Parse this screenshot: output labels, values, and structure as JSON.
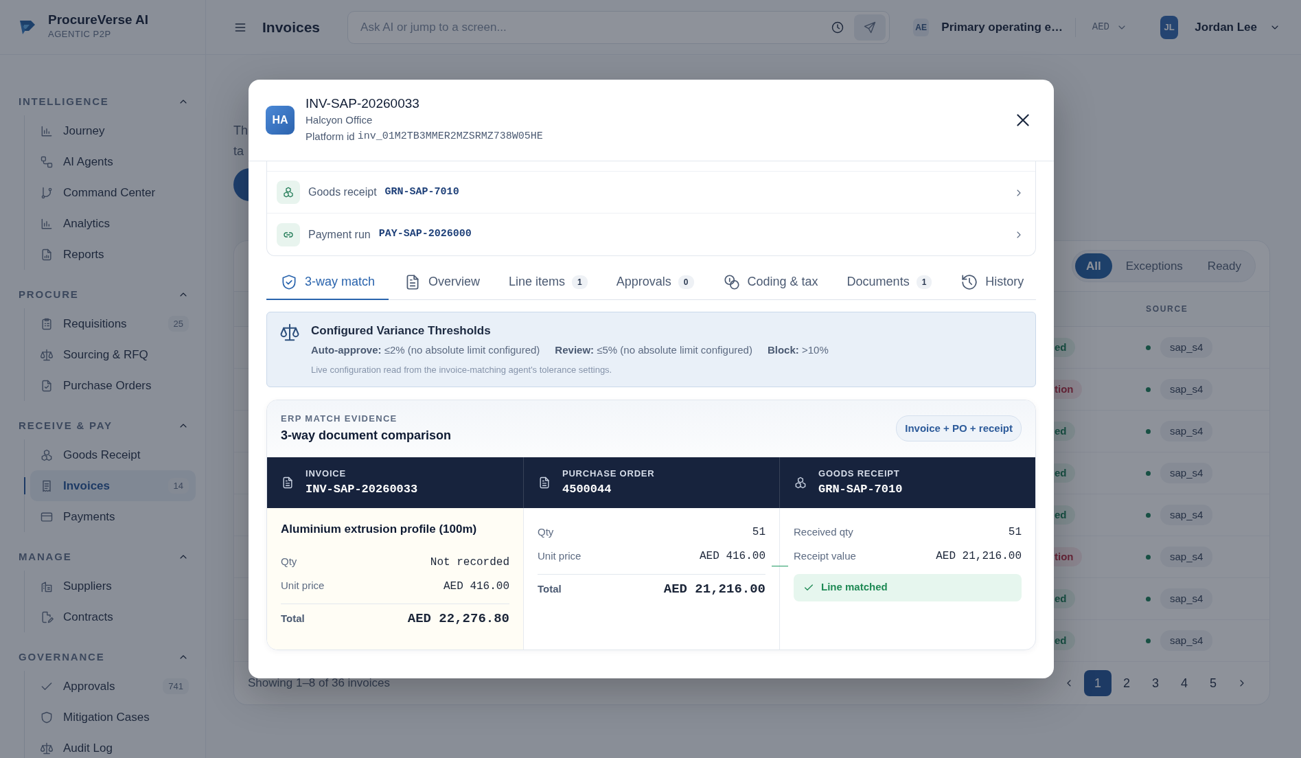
{
  "sidebar": {
    "brand": {
      "name": "ProcureVerse AI",
      "tagline": "AGENTIC P2P"
    },
    "sections": [
      {
        "title": "INTELLIGENCE",
        "expanded": true,
        "items": [
          {
            "label": "Journey",
            "selected": false
          },
          {
            "label": "AI Agents",
            "selected": false
          },
          {
            "label": "Command Center",
            "selected": false
          },
          {
            "label": "Analytics",
            "selected": false
          },
          {
            "label": "Reports",
            "selected": false
          }
        ]
      },
      {
        "title": "PROCURE",
        "expanded": true,
        "items": [
          {
            "label": "Requisitions",
            "count": "25",
            "selected": false
          },
          {
            "label": "Sourcing & RFQ",
            "selected": false
          },
          {
            "label": "Purchase Orders",
            "selected": false
          }
        ]
      },
      {
        "title": "RECEIVE & PAY",
        "expanded": true,
        "items": [
          {
            "label": "Goods Receipt",
            "selected": false
          },
          {
            "label": "Invoices",
            "count": "14",
            "selected": true
          },
          {
            "label": "Payments",
            "selected": false
          }
        ]
      },
      {
        "title": "MANAGE",
        "expanded": true,
        "items": [
          {
            "label": "Suppliers",
            "selected": false
          },
          {
            "label": "Contracts",
            "selected": false
          }
        ]
      },
      {
        "title": "GOVERNANCE",
        "expanded": true,
        "items": [
          {
            "label": "Approvals",
            "count": "741",
            "selected": false
          },
          {
            "label": "Mitigation Cases",
            "selected": false
          },
          {
            "label": "Audit Log",
            "selected": false
          }
        ]
      }
    ]
  },
  "header": {
    "title": "Invoices",
    "search": {
      "placeholder": "Ask AI or jump to a screen..."
    },
    "entity": {
      "code": "AE",
      "name": "Primary operating e…"
    },
    "currency": "AED",
    "user": {
      "initials": "JL",
      "name": "Jordan Lee"
    }
  },
  "page": {
    "intro_lines": [
      "Th",
      "ta"
    ],
    "filters": [
      {
        "label": "All",
        "selected": true
      },
      {
        "label": "Exceptions",
        "selected": false
      },
      {
        "label": "Ready",
        "selected": false
      }
    ],
    "table": {
      "columns": [
        "SOURCE"
      ],
      "rows": [
        {
          "status": "ed",
          "kind": "success",
          "source": "sap_s4"
        },
        {
          "status": "tion",
          "kind": "danger",
          "source": "sap_s4"
        },
        {
          "status": "ed",
          "kind": "success",
          "source": "sap_s4"
        },
        {
          "status": "ed",
          "kind": "success",
          "source": "sap_s4"
        },
        {
          "status": "ed",
          "kind": "success",
          "source": "sap_s4"
        },
        {
          "status": "tion",
          "kind": "danger",
          "source": "sap_s4"
        },
        {
          "status": "ed",
          "kind": "success",
          "source": "sap_s4"
        },
        {
          "status": "ed",
          "kind": "success",
          "source": "sap_s4"
        }
      ]
    },
    "footer": "Showing 1–8 of 36 invoices",
    "pagination": [
      {
        "label": "1",
        "selected": true
      },
      {
        "label": "2",
        "selected": false
      },
      {
        "label": "3",
        "selected": false
      },
      {
        "label": "4",
        "selected": false
      },
      {
        "label": "5",
        "selected": false
      }
    ]
  },
  "modal": {
    "avatar": "HA",
    "title": "INV-SAP-20260033",
    "supplier": "Halcyon Office",
    "platform_label": "Platform id",
    "platform_id": "inv_01M2TB3MMER2MZSRMZ738W05HE",
    "links": [
      {
        "label": "Goods receipt",
        "ref": "GRN-SAP-7010"
      },
      {
        "label": "Payment run",
        "ref": "PAY-SAP-2026000"
      }
    ],
    "tabs": [
      {
        "label": "3-way match",
        "selected": true
      },
      {
        "label": "Overview",
        "selected": false
      },
      {
        "label": "Line items",
        "count": "1",
        "selected": false
      },
      {
        "label": "Approvals",
        "count": "0",
        "selected": false
      },
      {
        "label": "Coding & tax",
        "selected": false
      },
      {
        "label": "Documents",
        "count": "1",
        "selected": false
      },
      {
        "label": "History",
        "selected": false
      }
    ],
    "thresholds": {
      "title": "Configured Variance Thresholds",
      "rules": [
        "**Auto-approve:** ≤2% (no absolute limit configured)",
        "**Review:** ≤5% (no absolute limit configured)",
        "**Block:** >10%"
      ],
      "note": "Live configuration read from the invoice-matching agent's tolerance settings."
    },
    "evidence": {
      "eyebrow": "ERP MATCH EVIDENCE",
      "title": "3-way document comparison",
      "pill": "Invoice + PO + receipt",
      "columns": [
        {
          "label": "INVOICE",
          "ref": "INV-SAP-20260033"
        },
        {
          "label": "PURCHASE ORDER",
          "ref": "4500044"
        },
        {
          "label": "GOODS RECEIPT",
          "ref": "GRN-SAP-7010"
        }
      ],
      "invoice": {
        "item": "Aluminium extrusion profile (100m)",
        "rows": [
          {
            "label": "Qty",
            "value": "Not recorded"
          },
          {
            "label": "Unit price",
            "value": "AED 416.00"
          }
        ],
        "total": {
          "label": "Total",
          "value": "AED 22,276.80"
        }
      },
      "po": {
        "rows": [
          {
            "label": "Qty",
            "value": "51"
          },
          {
            "label": "Unit price",
            "value": "AED 416.00"
          }
        ],
        "total": {
          "label": "Total",
          "value": "AED 21,216.00"
        }
      },
      "receipt": {
        "rows": [
          {
            "label": "Received qty",
            "value": "51"
          },
          {
            "label": "Receipt value",
            "value": "AED 21,216.00"
          }
        ],
        "status": "Line matched"
      }
    }
  }
}
